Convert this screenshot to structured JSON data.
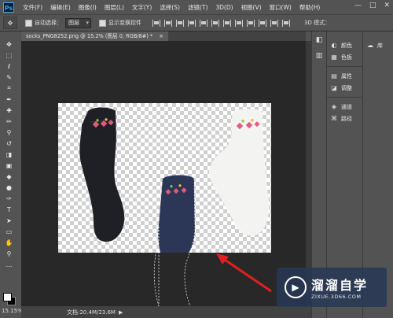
{
  "app": {
    "logo": "Ps",
    "window_controls": [
      "—",
      "□",
      "✕"
    ]
  },
  "menu": [
    "文件(F)",
    "编辑(E)",
    "图像(I)",
    "图层(L)",
    "文字(Y)",
    "选择(S)",
    "滤镜(T)",
    "3D(D)",
    "视图(V)",
    "窗口(W)",
    "帮助(H)"
  ],
  "options_bar": {
    "auto_select_label": "自动选择：",
    "auto_select_value": "图层",
    "show_transform_label": "显示变换控件",
    "mode_3d_label": "3D 模式："
  },
  "document": {
    "tab_title": "socks_PNG8252.png @ 15.2% (图层 0, RGB/8#) *",
    "tab_close": "×"
  },
  "toolbox": {
    "icons": [
      "move-icon",
      "marquee-icon",
      "lasso-icon",
      "quick-select-icon",
      "crop-icon",
      "eyedropper-icon",
      "healing-icon",
      "brush-icon",
      "stamp-icon",
      "history-brush-icon",
      "eraser-icon",
      "gradient-icon",
      "blur-icon",
      "dodge-icon",
      "pen-icon",
      "type-icon",
      "path-select-icon",
      "rectangle-icon",
      "hand-icon",
      "zoom-icon",
      "more-icon"
    ],
    "glyphs": [
      "✥",
      "⬚",
      "ℓ",
      "✎",
      "⌗",
      "✒",
      "✚",
      "✏",
      "⚲",
      "↺",
      "◨",
      "▣",
      "◆",
      "●",
      "✑",
      "T",
      "➤",
      "▭",
      "✋",
      "⚲",
      "…"
    ]
  },
  "status": {
    "zoom": "15.15%",
    "doc_info": "文档:20.4M/23.6M",
    "arrow": "▶"
  },
  "panels": {
    "group1": [
      {
        "icon": "color-icon",
        "glyph": "◐",
        "label": "颜色"
      },
      {
        "icon": "swatches-icon",
        "glyph": "▦",
        "label": "色板"
      }
    ],
    "group2": [
      {
        "icon": "properties-icon",
        "glyph": "▤",
        "label": "属性"
      },
      {
        "icon": "adjustments-icon",
        "glyph": "◪",
        "label": "调整"
      }
    ],
    "group3": [
      {
        "icon": "channels-icon",
        "glyph": "◈",
        "label": "通道"
      },
      {
        "icon": "paths-icon",
        "glyph": "⌘",
        "label": "路径"
      }
    ],
    "library": {
      "icon": "library-icon",
      "glyph": "☁",
      "label": "库"
    }
  },
  "watermark": {
    "title": "溜溜自学",
    "subtitle": "ZIXUE.3D66.COM"
  },
  "colors": {
    "ui_bg": "#535353",
    "canvas_bg": "#282828",
    "arrow_red": "#e02020",
    "dark_sock": "#1f1f26",
    "navy_sock": "#2c3656",
    "white_sock": "#f3f3f1"
  }
}
